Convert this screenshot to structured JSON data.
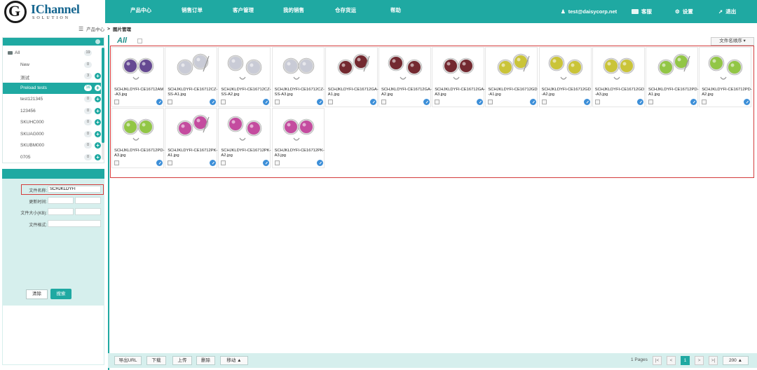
{
  "brand": {
    "letter": "G",
    "name": "IChannel",
    "sub": "SOLUTION"
  },
  "nav": {
    "items": [
      "产品中心",
      "销售订单",
      "客户管理",
      "我的销售",
      "仓存货运",
      "帮助"
    ],
    "user": "test@daisycorp.net",
    "service": "客服",
    "settings": "设置",
    "logout": "退出"
  },
  "breadcrumb": {
    "root": "产品中心",
    "separator": ">",
    "current": "图片管理"
  },
  "categories": [
    {
      "label": "All",
      "count": "19"
    },
    {
      "label": "New",
      "count": "0"
    },
    {
      "label": "测试",
      "count": "3"
    },
    {
      "label": "Preload tests",
      "count": "16"
    },
    {
      "label": "test121345",
      "count": "0"
    },
    {
      "label": "123456",
      "count": "0"
    },
    {
      "label": "SKUHC000",
      "count": "0"
    },
    {
      "label": "SKUAG000",
      "count": "0"
    },
    {
      "label": "SKUBM000",
      "count": "0"
    },
    {
      "label": "0705",
      "count": "0"
    }
  ],
  "search": {
    "filename_label": "文件名称:",
    "filename_value": "SCHJKLDYFI",
    "modified_label": "更新时间:",
    "size_label": "文件大小(KB):",
    "format_label": "文件格式:",
    "clear": "清除",
    "search": "搜索"
  },
  "gallery": {
    "all_label": "All",
    "sort_label": "文件名顺序 ▾",
    "items": [
      {
        "name": "SCHJKLDYFI-CE16712AM-A3.jpg",
        "color": "#5b3d8c"
      },
      {
        "name": "SCHJKLDYFI-CE16712CZ-SS-A1.jpg",
        "color": "#c8cad6"
      },
      {
        "name": "SCHJKLDYFI-CE16712CZ-SS-A2.jpg",
        "color": "#c8cad6"
      },
      {
        "name": "SCHJKLDYFI-CE16712CZ-SS-A3.jpg",
        "color": "#c8cad6"
      },
      {
        "name": "SCHJKLDYFI-CE16712GA-A1.jpg",
        "color": "#6a1a22"
      },
      {
        "name": "SCHJKLDYFI-CE16712GA-A2.jpg",
        "color": "#6a1a22"
      },
      {
        "name": "SCHJKLDYFI-CE16712GA-A3.jpg",
        "color": "#6a1a22"
      },
      {
        "name": "SCHJKLDYFI-CE16712GD-A1.jpg",
        "color": "#c9c22a"
      },
      {
        "name": "SCHJKLDYFI-CE16712GD-A2.jpg",
        "color": "#c9c22a"
      },
      {
        "name": "SCHJKLDYFI-CE16712GD-A3.jpg",
        "color": "#c9c22a"
      },
      {
        "name": "SCHJKLDYFI-CE16712PD-A1.jpg",
        "color": "#8cc43a"
      },
      {
        "name": "SCHJKLDYFI-CE16712PD-A2.jpg",
        "color": "#8cc43a"
      },
      {
        "name": "SCHJKLDYFI-CE16712PD-A3.jpg",
        "color": "#8cc43a"
      },
      {
        "name": "SCHJKLDYFI-CE16712PK-A1.jpg",
        "color": "#c2409a"
      },
      {
        "name": "SCHJKLDYFI-CE16712PK-A2.jpg",
        "color": "#c2409a"
      },
      {
        "name": "SCHJKLDYFI-CE16712PK-A3.jpg",
        "color": "#c2409a"
      }
    ]
  },
  "toolbar": {
    "export": "导出URL",
    "download": "下载",
    "upload": "上传",
    "delete": "删除",
    "move": "移动 ▲"
  },
  "pagination": {
    "summary": "1 Pages",
    "first": "|<",
    "prev": "<",
    "current": "1",
    "next": ">",
    "last": ">|",
    "page_size": "200 ▲"
  },
  "colors": {
    "accent": "#1fa9a2",
    "highlight": "#d43c3c"
  }
}
